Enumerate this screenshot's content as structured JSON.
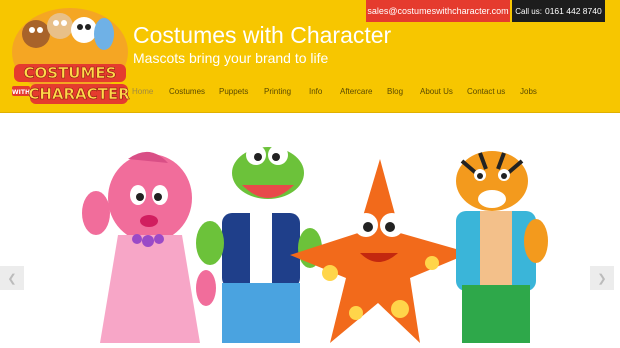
{
  "header": {
    "site_title": "Costumes with Character",
    "tagline": "Mascots bring your brand to life",
    "email": "sales@costumeswithcharacter.com",
    "call_label": "Call us:",
    "call_number": "0161 442 8740",
    "logo_text_line1": "COSTUMES",
    "logo_text_line2": "CHARACTER",
    "logo_text_small": "WITH"
  },
  "nav": {
    "items": [
      {
        "label": "Home",
        "active": true
      },
      {
        "label": "Costumes"
      },
      {
        "label": "Puppets"
      },
      {
        "label": "Printing"
      },
      {
        "label": "Info"
      },
      {
        "label": "Aftercare"
      },
      {
        "label": "Blog"
      },
      {
        "label": "About Us"
      },
      {
        "label": "Contact us"
      },
      {
        "label": "Jobs"
      }
    ]
  },
  "slider": {
    "prev_icon": "chevron-left-icon",
    "next_icon": "chevron-right-icon"
  },
  "colors": {
    "header_bg": "#f7c600",
    "email_bg": "#e53b2e",
    "call_bg": "#1d1d1d"
  }
}
